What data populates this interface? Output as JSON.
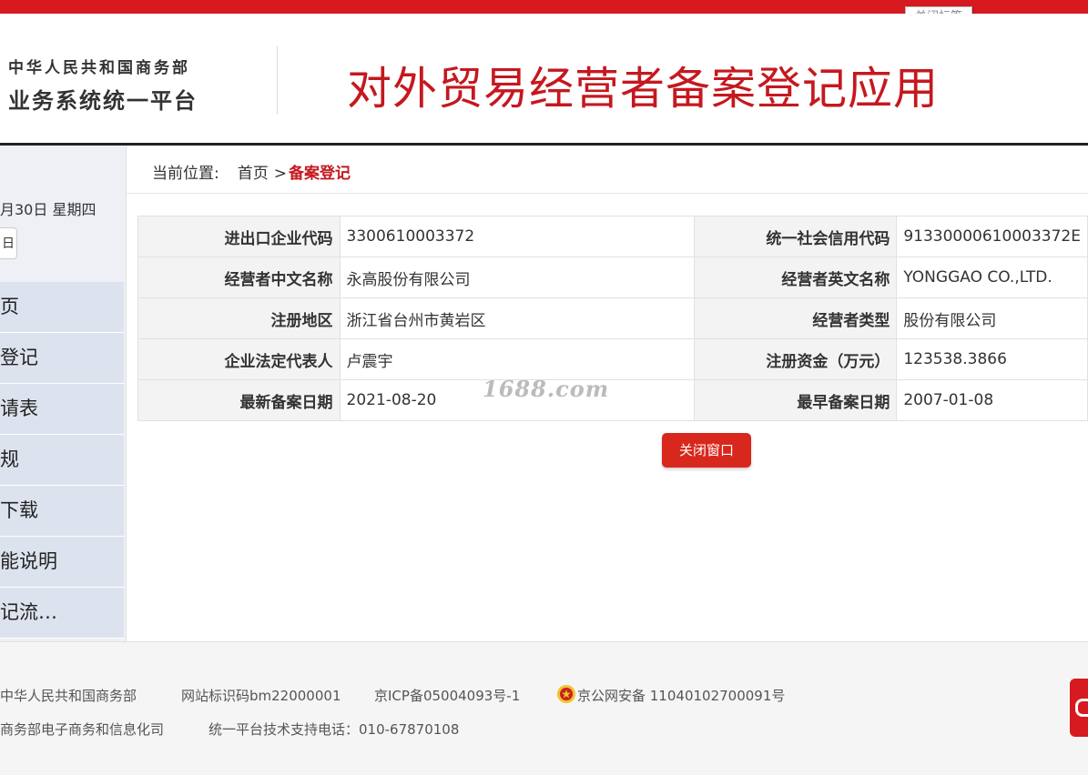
{
  "close_tab_label": "关闭标签",
  "header": {
    "org_line1": "中华人民共和国商务部",
    "org_line2": "业务系统统一平台",
    "app_title": "对外贸易经营者备案登记应用"
  },
  "sidebar": {
    "date": "月30日 星期四",
    "button_label": "日",
    "menu": [
      "页",
      "登记",
      "请表",
      "规",
      "下载",
      "能说明",
      "记流…"
    ]
  },
  "breadcrumb": {
    "label": "当前位置:",
    "home": "首页",
    "separator": ">",
    "current": "备案登记"
  },
  "record": {
    "rows": [
      {
        "k1": "进出口企业代码",
        "v1": "3300610003372",
        "k2": "统一社会信用代码",
        "v2": "91330000610003372E"
      },
      {
        "k1": "经营者中文名称",
        "v1": "永高股份有限公司",
        "k2": "经营者英文名称",
        "v2": "YONGGAO CO.,LTD."
      },
      {
        "k1": "注册地区",
        "v1": "浙江省台州市黄岩区",
        "k2": "经营者类型",
        "v2": "股份有限公司"
      },
      {
        "k1": "企业法定代表人",
        "v1": "卢震宇",
        "k2": "注册资金（万元）",
        "v2": "123538.3866"
      },
      {
        "k1": "最新备案日期",
        "v1": "2021-08-20",
        "k2": "最早备案日期",
        "v2": "2007-01-08"
      }
    ]
  },
  "watermark": "1688.com",
  "close_window_label": "关闭窗口",
  "footer": {
    "org": "中华人民共和国商务部",
    "site_id": "网站标识码bm22000001",
    "icp": "京ICP备05004093号-1",
    "police": "京公网安备 11040102700091号",
    "dept": "商务部电子商务和信息化司",
    "support": "统一平台技术支持电话：010-67870108"
  }
}
